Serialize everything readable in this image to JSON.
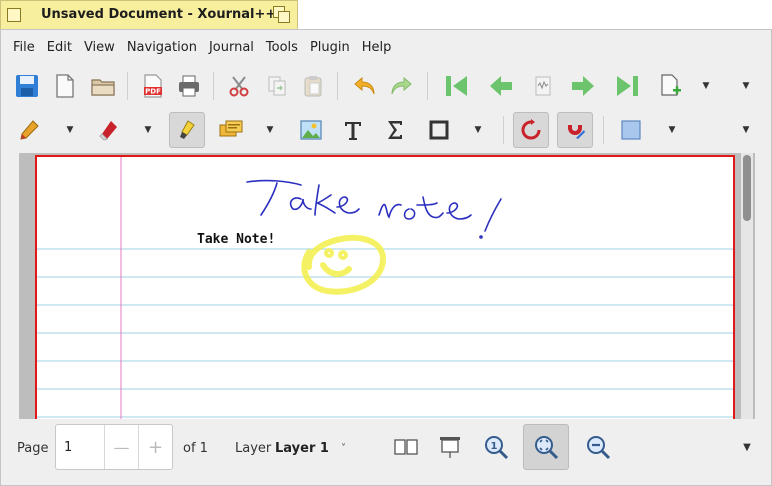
{
  "window": {
    "title": "Unsaved Document - Xournal++"
  },
  "menu": [
    "File",
    "Edit",
    "View",
    "Navigation",
    "Journal",
    "Tools",
    "Plugin",
    "Help"
  ],
  "toolbar1": [
    {
      "name": "save-icon"
    },
    {
      "name": "new-document-icon"
    },
    {
      "name": "open-folder-icon"
    },
    {
      "name": "export-pdf-icon",
      "label": "PDF"
    },
    {
      "name": "print-icon"
    },
    {
      "name": "cut-icon"
    },
    {
      "name": "copy-icon"
    },
    {
      "name": "paste-icon"
    },
    {
      "name": "undo-icon"
    },
    {
      "name": "redo-icon"
    },
    {
      "name": "first-page-icon"
    },
    {
      "name": "previous-page-icon"
    },
    {
      "name": "goto-page-icon"
    },
    {
      "name": "next-page-icon"
    },
    {
      "name": "last-page-icon"
    },
    {
      "name": "add-page-icon"
    }
  ],
  "toolbar2": [
    {
      "name": "pen-tool-icon"
    },
    {
      "name": "eraser-tool-icon"
    },
    {
      "name": "highlighter-tool-icon",
      "active": true
    },
    {
      "name": "paint-tool-icon"
    },
    {
      "name": "image-tool-icon"
    },
    {
      "name": "text-tool-icon"
    },
    {
      "name": "math-tex-icon"
    },
    {
      "name": "shape-rectangle-icon"
    },
    {
      "name": "shape-recognizer-icon",
      "active": true
    },
    {
      "name": "snap-grid-icon",
      "active": true
    },
    {
      "name": "color-picker-icon"
    }
  ],
  "document": {
    "typed_text": "Take Note!",
    "handwriting": "Take note!",
    "colors": {
      "page_border": "#e01818",
      "ruled_line": "#9fd0e6",
      "margin_line": "#e878c0",
      "ink": "#2b2fbf",
      "highlighter": "#f3f04a"
    }
  },
  "statusbar": {
    "page_label": "Page",
    "page_value": "1",
    "page_of": "of 1",
    "layer_label": "Layer",
    "layer_value": "Layer 1",
    "layer_dropdown": "˅",
    "zoom_fit_active": true
  }
}
